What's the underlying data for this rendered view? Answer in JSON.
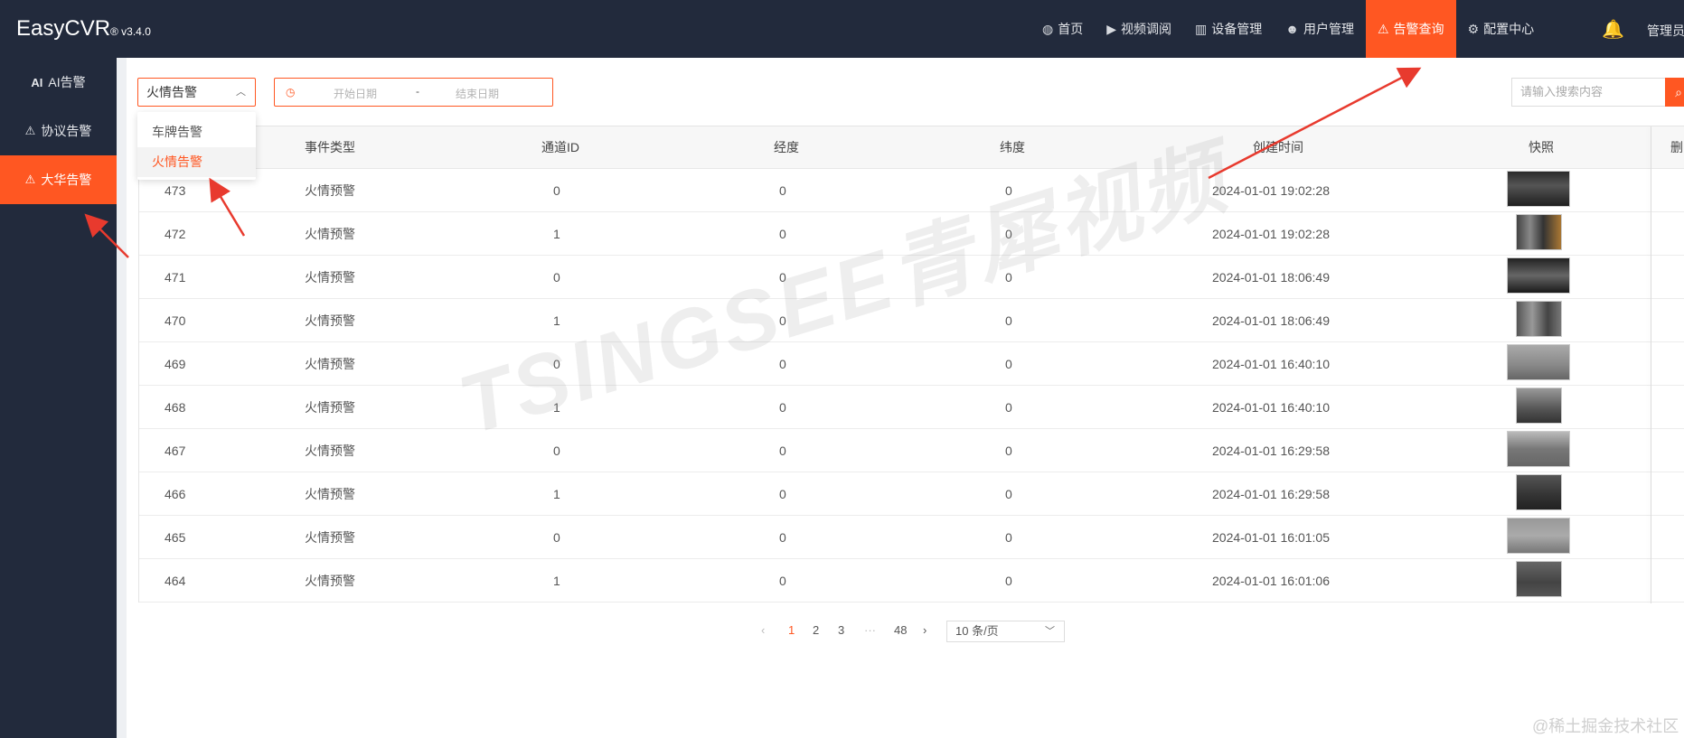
{
  "header": {
    "brand": "EasyCVR",
    "version": "® v3.4.0",
    "nav": [
      {
        "label": "首页",
        "icon": "◍"
      },
      {
        "label": "视频调阅",
        "icon": "▶"
      },
      {
        "label": "设备管理",
        "icon": "▥"
      },
      {
        "label": "用户管理",
        "icon": "☻"
      },
      {
        "label": "告警查询",
        "icon": "⚠"
      },
      {
        "label": "配置中心",
        "icon": "⚙"
      }
    ],
    "bell_icon": "🔔",
    "user": "管理员"
  },
  "sidebar": {
    "items": [
      {
        "label": "AI告警",
        "icon": "AI"
      },
      {
        "label": "协议告警",
        "icon": "⚠"
      },
      {
        "label": "大华告警",
        "icon": "⚠"
      }
    ]
  },
  "filters": {
    "alarm_type": "火情告警",
    "options": [
      "车牌告警",
      "火情告警"
    ],
    "start_placeholder": "开始日期",
    "separator": "-",
    "end_placeholder": "结束日期",
    "search_placeholder": "请输入搜索内容"
  },
  "table": {
    "columns": [
      "事件类型",
      "通道ID",
      "经度",
      "纬度",
      "创建时间",
      "快照",
      "删除"
    ],
    "rows": [
      {
        "id": "473",
        "type": "火情预警",
        "channel": "0",
        "lng": "0",
        "lat": "0",
        "time": "2024-01-01 19:02:28"
      },
      {
        "id": "472",
        "type": "火情预警",
        "channel": "1",
        "lng": "0",
        "lat": "0",
        "time": "2024-01-01 19:02:28"
      },
      {
        "id": "471",
        "type": "火情预警",
        "channel": "0",
        "lng": "0",
        "lat": "0",
        "time": "2024-01-01 18:06:49"
      },
      {
        "id": "470",
        "type": "火情预警",
        "channel": "1",
        "lng": "0",
        "lat": "0",
        "time": "2024-01-01 18:06:49"
      },
      {
        "id": "469",
        "type": "火情预警",
        "channel": "0",
        "lng": "0",
        "lat": "0",
        "time": "2024-01-01 16:40:10"
      },
      {
        "id": "468",
        "type": "火情预警",
        "channel": "1",
        "lng": "0",
        "lat": "0",
        "time": "2024-01-01 16:40:10"
      },
      {
        "id": "467",
        "type": "火情预警",
        "channel": "0",
        "lng": "0",
        "lat": "0",
        "time": "2024-01-01 16:29:58"
      },
      {
        "id": "466",
        "type": "火情预警",
        "channel": "1",
        "lng": "0",
        "lat": "0",
        "time": "2024-01-01 16:29:58"
      },
      {
        "id": "465",
        "type": "火情预警",
        "channel": "0",
        "lng": "0",
        "lat": "0",
        "time": "2024-01-01 16:01:05"
      },
      {
        "id": "464",
        "type": "火情预警",
        "channel": "1",
        "lng": "0",
        "lat": "0",
        "time": "2024-01-01 16:01:06"
      }
    ]
  },
  "pagination": {
    "prev": "‹",
    "pages": [
      "1",
      "2",
      "3"
    ],
    "ellipsis": "···",
    "last": "48",
    "next": "›",
    "page_size": "10 条/页"
  },
  "watermark": "TSINGSEE青犀视频",
  "footer": "@稀土掘金技术社区",
  "accent_color": "#ff5722"
}
